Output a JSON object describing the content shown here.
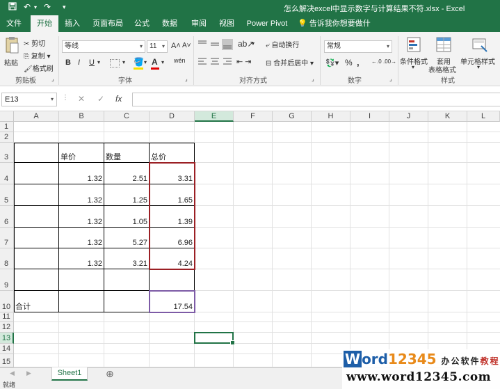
{
  "window": {
    "title": "怎么解决excel中显示数字与计算结果不符.xlsx - Excel"
  },
  "tabs": [
    {
      "label": "文件"
    },
    {
      "label": "开始"
    },
    {
      "label": "插入"
    },
    {
      "label": "页面布局"
    },
    {
      "label": "公式"
    },
    {
      "label": "数据"
    },
    {
      "label": "审阅"
    },
    {
      "label": "视图"
    },
    {
      "label": "Power Pivot"
    }
  ],
  "tell_me": "告诉我你想要做什么",
  "ribbon": {
    "clipboard": {
      "paste": "粘贴",
      "cut": "剪切",
      "copy": "复制",
      "format_painter": "格式刷",
      "label": "剪贴板"
    },
    "font": {
      "name": "等线",
      "size": "11",
      "bold": "B",
      "italic": "I",
      "underline": "U",
      "label": "字体"
    },
    "alignment": {
      "wrap": "自动换行",
      "merge": "合并后居中",
      "label": "对齐方式"
    },
    "number": {
      "format": "常规",
      "percent": "%",
      "comma": ",",
      "label": "数字"
    },
    "styles": {
      "conditional": "条件格式",
      "table_line1": "套用",
      "table_line2": "表格格式",
      "cell_styles": "单元格样式",
      "label": "样式"
    }
  },
  "formula_bar": {
    "name_box": "E13",
    "cancel": "✕",
    "enter": "✓",
    "fx": "fx",
    "formula": ""
  },
  "columns": [
    "A",
    "B",
    "C",
    "D",
    "E",
    "F",
    "G",
    "H",
    "I",
    "J",
    "K",
    "L"
  ],
  "rows": [
    "1",
    "2",
    "3",
    "4",
    "5",
    "6",
    "7",
    "8",
    "9",
    "10",
    "11",
    "12",
    "13",
    "14",
    "15"
  ],
  "cells": {
    "A10": "合计",
    "B3": "单价",
    "C3": "数量",
    "D3": "总价",
    "B4": "1.32",
    "C4": "2.51",
    "D4": "3.31",
    "B5": "1.32",
    "C5": "1.25",
    "D5": "1.65",
    "B6": "1.32",
    "C6": "1.05",
    "D6": "1.39",
    "B7": "1.32",
    "C7": "5.27",
    "D7": "6.96",
    "B8": "1.32",
    "C8": "3.21",
    "D8": "4.24",
    "D10": "17.54"
  },
  "sheet_tabs": [
    {
      "label": "Sheet1"
    }
  ],
  "add_sheet": "⊕",
  "status": "就绪",
  "watermark": {
    "w": "W",
    "ord": "ord",
    "num": "12345",
    "zh1": "办公软件",
    "zh2": "教程",
    "url": "www.word12345.com"
  },
  "colors": {
    "excel_green": "#217346",
    "highlight_red": "#9b1f24",
    "highlight_purple": "#7d5ba6"
  }
}
